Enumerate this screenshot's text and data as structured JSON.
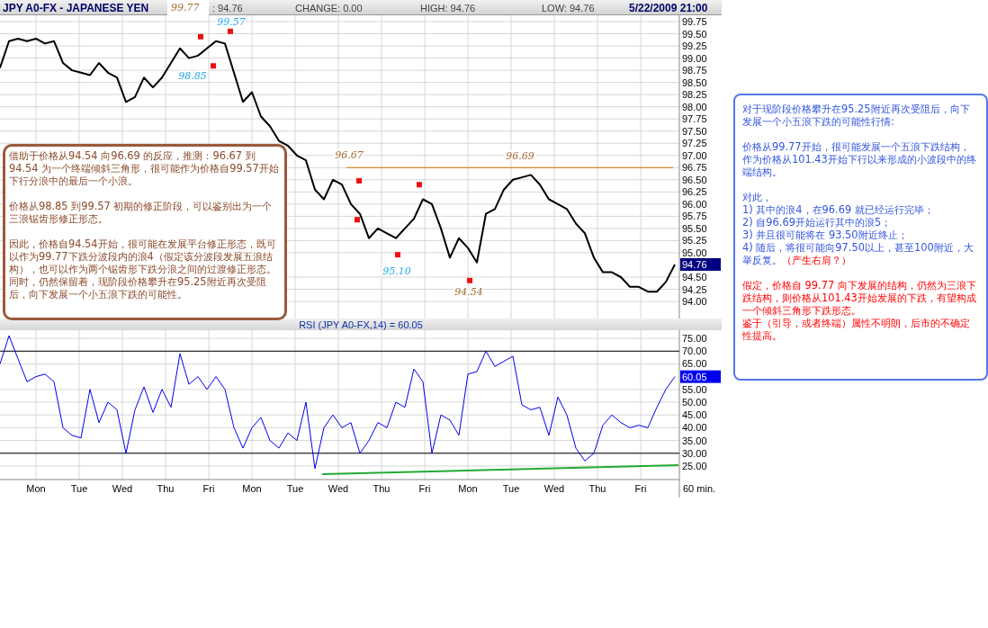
{
  "header": {
    "title": "JPY A0-FX - JAPANESE YEN",
    "marker": "99.77",
    "last": ": 94.76",
    "change": "CHANGE: 0.00",
    "high": "HIGH: 94.76",
    "low": "LOW: 94.76",
    "datetime": "5/22/2009 21:00"
  },
  "price_chart": {
    "last_badge": "94.76",
    "chart_data": {
      "type": "line",
      "ylim": [
        93.65,
        99.88
      ],
      "grid": true,
      "series": [
        {
          "color": "#000000",
          "values": [
            98.8,
            99.35,
            99.4,
            99.35,
            99.4,
            99.3,
            99.35,
            98.9,
            98.75,
            98.7,
            98.65,
            98.9,
            98.7,
            98.6,
            98.1,
            98.2,
            98.6,
            98.4,
            98.6,
            98.9,
            99.2,
            99.0,
            99.05,
            99.2,
            99.35,
            99.3,
            98.7,
            98.1,
            98.3,
            97.8,
            97.6,
            97.3,
            97.2,
            97.0,
            96.9,
            96.3,
            96.1,
            96.5,
            96.4,
            96.0,
            95.8,
            95.3,
            95.5,
            95.4,
            95.3,
            95.5,
            95.7,
            96.1,
            96.0,
            95.5,
            94.9,
            95.3,
            95.1,
            94.8,
            95.8,
            95.9,
            96.3,
            96.5,
            96.55,
            96.6,
            96.4,
            96.1,
            96.0,
            95.9,
            95.6,
            95.4,
            94.9,
            94.6,
            94.6,
            94.5,
            94.3,
            94.3,
            94.2,
            94.2,
            94.4,
            94.76
          ]
        }
      ],
      "yticks": [
        {
          "value": 94,
          "label": "94.00"
        },
        {
          "value": 94.25,
          "label": "94.25"
        },
        {
          "value": 94.5,
          "label": "94.50"
        },
        {
          "value": 95,
          "label": "95.00"
        },
        {
          "value": 95.25,
          "label": "95.25"
        },
        {
          "value": 95.5,
          "label": "95.50"
        },
        {
          "value": 95.75,
          "label": "95.75"
        },
        {
          "value": 96,
          "label": "96.00"
        },
        {
          "value": 96.25,
          "label": "96.25"
        },
        {
          "value": 96.5,
          "label": "96.50"
        },
        {
          "value": 96.75,
          "label": "96.75"
        },
        {
          "value": 97,
          "label": "97.00"
        },
        {
          "value": 97.25,
          "label": "97.25"
        },
        {
          "value": 97.5,
          "label": "97.50"
        },
        {
          "value": 97.75,
          "label": "97.75"
        },
        {
          "value": 98,
          "label": "98.00"
        },
        {
          "value": 98.25,
          "label": "98.25"
        },
        {
          "value": 98.5,
          "label": "98.50"
        },
        {
          "value": 98.75,
          "label": "98.75"
        },
        {
          "value": 99,
          "label": "99.00"
        },
        {
          "value": 99.25,
          "label": "99.25"
        },
        {
          "value": 99.5,
          "label": "99.50"
        },
        {
          "value": 99.75,
          "label": "99.75"
        }
      ],
      "annotations": [
        "99.57",
        "98.85",
        "96.67",
        "96.69",
        "95.10",
        "94.54"
      ]
    }
  },
  "rsi_chart": {
    "last_badge": "60.05",
    "interval": "60 min.",
    "day_labels": [
      "Mon",
      "Tue",
      "Wed",
      "Thu",
      "Fri",
      "Mon",
      "Tue",
      "Wed",
      "Thu",
      "Fri",
      "Mon",
      "Tue",
      "Wed",
      "Thu",
      "Fri"
    ],
    "chart_data": {
      "type": "line",
      "title": "RSI (JPY A0-FX,14) = 60.05",
      "ylim": [
        19.7,
        78.2
      ],
      "grid": true,
      "series": [
        {
          "color": "#0000ee",
          "values": [
            65,
            76,
            67,
            58,
            60,
            61,
            58,
            40,
            37,
            36,
            55,
            42,
            50,
            47,
            30,
            47,
            56,
            46,
            55,
            48,
            69,
            57,
            60,
            55,
            60,
            55,
            40,
            32,
            40,
            44,
            35,
            32,
            38,
            35,
            50,
            24,
            40,
            45,
            40,
            42,
            30,
            35,
            42,
            40,
            50,
            48,
            63,
            58,
            30,
            45,
            43,
            37,
            61,
            62,
            70,
            64,
            66,
            68,
            49,
            47,
            48,
            37,
            52,
            45,
            32,
            27,
            30,
            41,
            45,
            42,
            40,
            41,
            40,
            48,
            55,
            60
          ]
        }
      ],
      "yticks": [
        {
          "value": 25,
          "label": "25.00"
        },
        {
          "value": 30,
          "label": "30.00"
        },
        {
          "value": 35,
          "label": "35.00"
        },
        {
          "value": 40,
          "label": "40.00"
        },
        {
          "value": 45,
          "label": "45.00"
        },
        {
          "value": 50,
          "label": "50.00"
        },
        {
          "value": 55,
          "label": "55.00"
        },
        {
          "value": 65,
          "label": "65.00"
        },
        {
          "value": 70,
          "label": "70.00"
        },
        {
          "value": 75,
          "label": "75.00"
        }
      ]
    }
  },
  "left_note": {
    "blocks": [
      [
        "借助于价格从94.54 向96.69 的反应，推测：96.67 到94.54 为一个终端倾斜三角形，很可能作为价格自99.57开始下行分浪中的最后一个小浪。"
      ],
      [
        "价格从98.85 到99.57 初期的修正阶段，可以鉴别出为一个三浪锯齿形修正形态。"
      ],
      [
        "因此，价格自94.54开始，很可能在发展平台修正形态，既可以作为99.77下跌分波段内的浪4（假定该分波段发展五浪结构），也可以作为两个锯齿形下跌分浪之间的过渡修正形态。",
        "同时，仍然保留着，现阶段价格攀升在95.25附近再次受阻后，向下发展一个小五浪下跌的可能性。"
      ]
    ]
  },
  "right_note": {
    "blocks": [
      [
        [
          {
            "text": "对于现阶段价格攀升在95.25附近再次受阻后，向下发展一个小五浪下跌的可能性行情:",
            "kind": "normal"
          }
        ]
      ],
      [
        [
          {
            "text": "价格从99.77开始，很可能发展一个五浪下跌结构，作为价格从101.43开始下行以来形成的小波段中的终端结构。",
            "kind": "normal"
          }
        ]
      ],
      [
        [
          {
            "text": "对此，",
            "kind": "normal"
          }
        ],
        [
          {
            "text": "1) 其中的浪4，在96.69 就已经运行完毕；",
            "kind": "normal"
          }
        ],
        [
          {
            "text": "2) 自96.69开始运行其中的浪5；",
            "kind": "normal"
          }
        ],
        [
          {
            "text": "3) 并且很可能将在 93.50附近终止；",
            "kind": "normal"
          }
        ],
        [
          {
            "text": "4) 随后，将很可能向97.50以上，甚至100附近，大举反复。",
            "kind": "normal"
          },
          {
            "text": "（产生右肩？）",
            "kind": "alert"
          }
        ]
      ],
      [
        [
          {
            "text": "假定，价格自 99.77 向下发展的结构，仍然为三浪下跌结构，则价格从101.43开始发展的下跌，有望构成一个倾斜三角形下跌形态。",
            "kind": "alert"
          }
        ],
        [
          {
            "text": "鉴于（引导，或者终端）属性不明朗，后市的不确定性提高。",
            "kind": "alert"
          }
        ]
      ]
    ]
  }
}
